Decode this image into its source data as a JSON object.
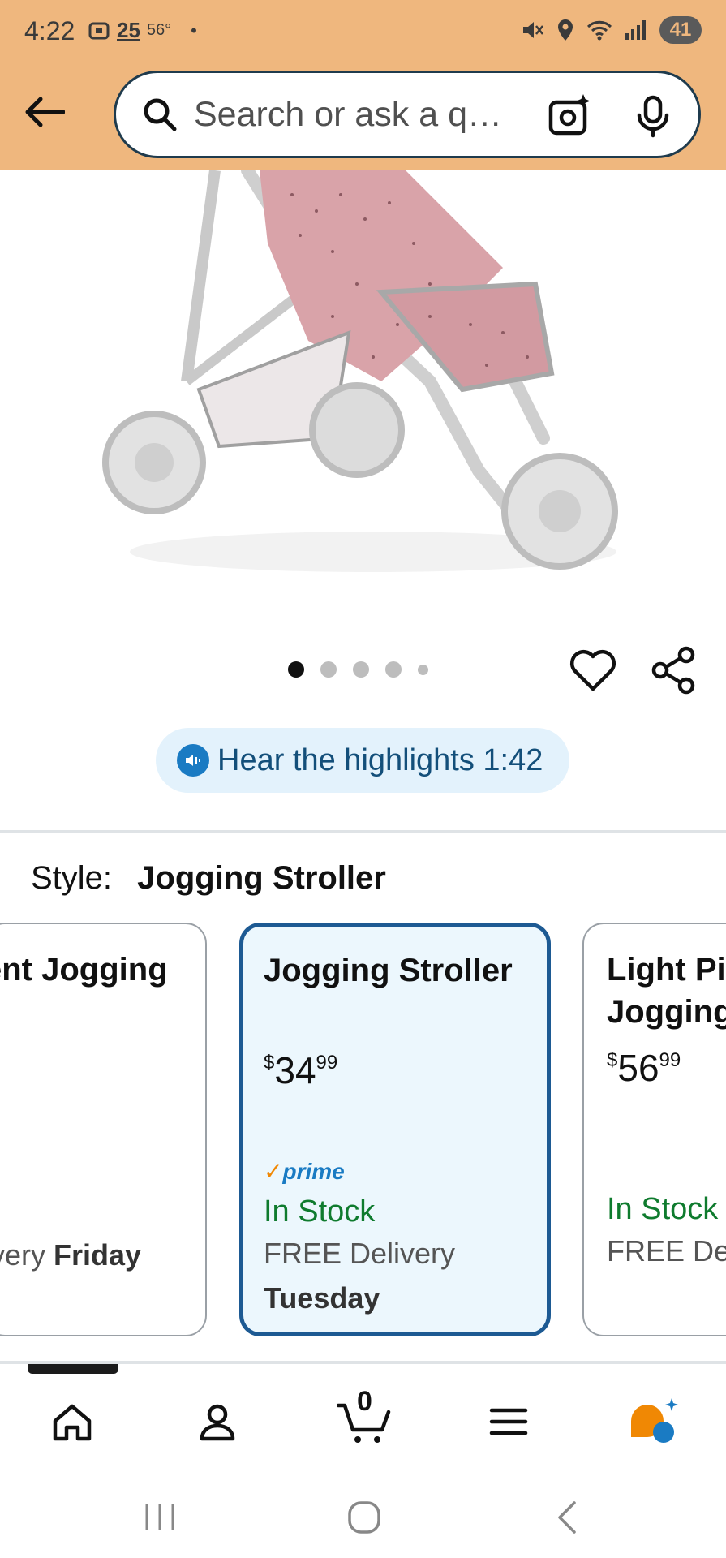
{
  "status_bar": {
    "time": "4:22",
    "temperature": "56°",
    "battery": "41",
    "icons": [
      "screenshot-icon",
      "news-25-icon",
      "mute-icon",
      "location-icon",
      "wifi-icon",
      "signal-icon"
    ]
  },
  "search": {
    "placeholder": "Search or ask a q…"
  },
  "carousel": {
    "dot_count": 5,
    "active_index": 0
  },
  "audio": {
    "label": "Hear the highlights 1:42"
  },
  "style_selector": {
    "label": "Style:",
    "selected": "Jogging Stroller",
    "options": [
      {
        "title_lines": [
          "ent Jogging"
        ],
        "price_whole": "",
        "price_fraction": "",
        "prime": false,
        "stock": "",
        "delivery": "ivery ",
        "delivery_day": "Friday"
      },
      {
        "title_lines": [
          "Jogging Stroller"
        ],
        "price_whole": "34",
        "price_fraction": "99",
        "prime": true,
        "prime_label": "prime",
        "stock": "In Stock",
        "delivery": "FREE Delivery",
        "delivery_day": "Tuesday"
      },
      {
        "title_lines": [
          "Light Pi",
          "Jogging"
        ],
        "price_whole": "56",
        "price_fraction": "99",
        "prime": false,
        "stock": "In Stock",
        "delivery": "FREE Del",
        "delivery_day": ""
      }
    ]
  },
  "bottom_nav": {
    "cart_count": "0",
    "items": [
      "home-icon",
      "account-icon",
      "cart-icon",
      "menu-icon",
      "rufus-ai-icon"
    ]
  },
  "colors": {
    "header_bg": "#efb77e",
    "selected_border": "#1d5a93",
    "in_stock": "#0f7b2e",
    "prime_blue": "#1a7bc3"
  }
}
